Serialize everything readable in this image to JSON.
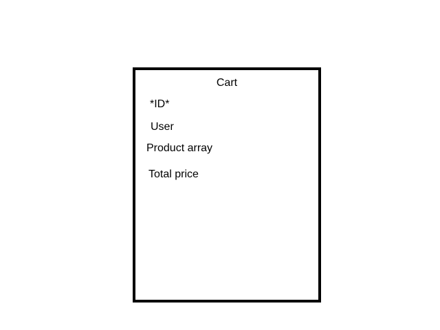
{
  "entity": {
    "title": "Cart",
    "fields": [
      "*ID*",
      "User",
      "Product array",
      "Total price"
    ]
  }
}
